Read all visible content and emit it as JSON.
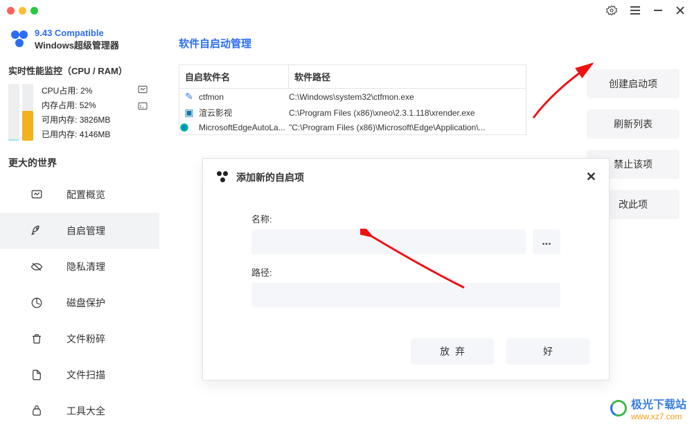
{
  "window": {
    "settings_icon": "settings",
    "menu_icon": "menu",
    "minimize_icon": "minimize",
    "close_icon": "close"
  },
  "app": {
    "version_line": "9.43 Compatible",
    "name": "Windows超级管理器"
  },
  "perf": {
    "title": "实时性能监控（CPU / RAM）",
    "cpu_label": "CPU占用:",
    "cpu_value": "2%",
    "cpu_percent": 2,
    "ram_label": "内存占用:",
    "ram_value": "52%",
    "ram_percent": 52,
    "avail_label": "可用内存:",
    "avail_value": "3826MB",
    "used_label": "已用内存:",
    "used_value": "4146MB",
    "cpu_bar_color": "#9fe0ef",
    "ram_bar_color": "#f2b21e"
  },
  "section_title": "更大的世界",
  "nav": [
    {
      "key": "overview",
      "label": "配置概览"
    },
    {
      "key": "startup",
      "label": "自启管理",
      "active": true
    },
    {
      "key": "privacy",
      "label": "隐私清理"
    },
    {
      "key": "disk",
      "label": "磁盘保护"
    },
    {
      "key": "shred",
      "label": "文件粉碎"
    },
    {
      "key": "scan",
      "label": "文件扫描"
    },
    {
      "key": "tools",
      "label": "工具大全"
    }
  ],
  "page": {
    "title": "软件自启动管理",
    "col1": "自启软件名",
    "col2": "软件路径",
    "rows": [
      {
        "icon": "pen",
        "name": "ctfmon",
        "path": "C:\\Windows\\system32\\ctfmon.exe"
      },
      {
        "icon": "app",
        "name": "渲云影视",
        "path": "C:\\Program Files (x86)\\xneo\\2.3.1.118\\xrender.exe"
      },
      {
        "icon": "edge",
        "name": "MicrosoftEdgeAutoLa...",
        "path": "\"C:\\Program Files (x86)\\Microsoft\\Edge\\Application\\..."
      }
    ]
  },
  "actions": {
    "create": "创建启动项",
    "refresh": "刷新列表",
    "forbid": "禁止该项",
    "modify": "改此项"
  },
  "dialog": {
    "title": "添加新的自启项",
    "name_label": "名称:",
    "path_label": "路径:",
    "name_value": "",
    "path_value": "",
    "browse": "...",
    "cancel": "放弃",
    "ok": "好"
  },
  "watermark": {
    "name": "极光下载站",
    "url": "www.xz7.com"
  }
}
